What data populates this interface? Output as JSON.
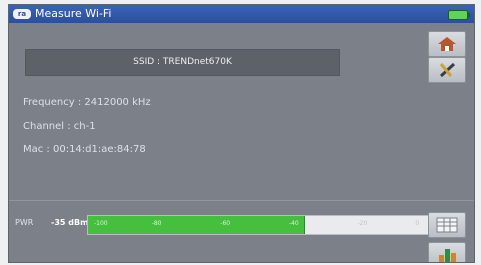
{
  "window": {
    "title": "Measure Wi-Fi",
    "app_icon_text": "ra"
  },
  "network": {
    "ssid": "SSID : TRENDnet670K",
    "frequency": "Frequency : 2412000 kHz",
    "channel": "Channel : ch-1",
    "mac": "Mac : 00:14:d1:ae:84:78"
  },
  "power": {
    "label": "PWR",
    "value": "-35 dBm",
    "level_fraction": 0.63,
    "ticks": [
      "-100",
      "-80",
      "-60",
      "-40",
      "-20",
      "0"
    ]
  },
  "icons": {
    "battery": "battery-icon",
    "home": "home-icon",
    "tools": "tools-icon",
    "grid": "grid-icon",
    "chart": "bar-chart-icon"
  }
}
